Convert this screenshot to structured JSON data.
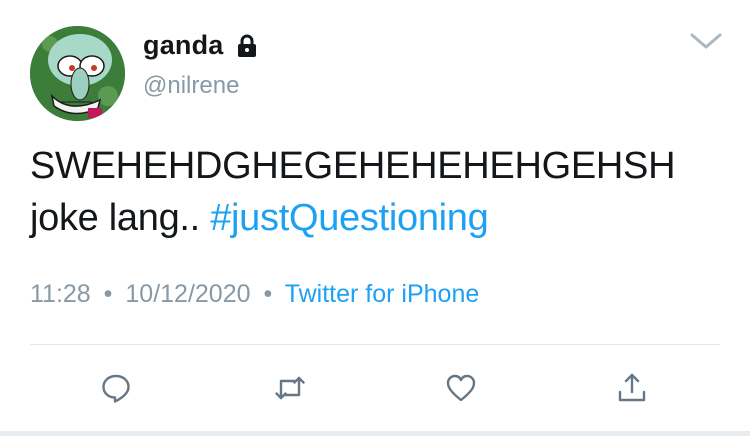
{
  "user": {
    "display_name": "ganda",
    "handle": "@nilrene",
    "protected_icon": "lock-icon",
    "avatar_icon": "squidward-avatar"
  },
  "tweet": {
    "text_line1": "SWEHEHDGHEGEHEHEHEHGEHSH",
    "text_line2_plain": "joke lang..",
    "hashtag": "#justQuestioning"
  },
  "meta": {
    "time": "11:28",
    "date": "10/12/2020",
    "separator": "•",
    "source": "Twitter for iPhone"
  },
  "actions": {
    "reply_icon": "reply-icon",
    "retweet_icon": "retweet-icon",
    "like_icon": "heart-icon",
    "share_icon": "share-icon",
    "menu_icon": "chevron-down-icon"
  },
  "colors": {
    "link": "#1da1f2",
    "secondary": "#8899a6",
    "text": "#14171a"
  }
}
